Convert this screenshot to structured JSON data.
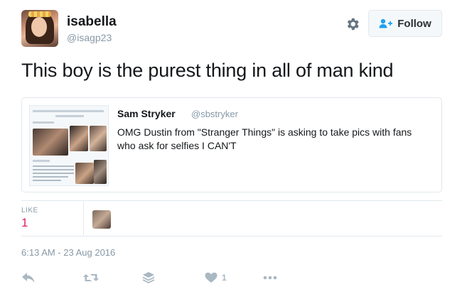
{
  "user": {
    "name": "isabella",
    "handle": "@isagp23"
  },
  "follow_button": {
    "label": "Follow"
  },
  "tweet": {
    "text": "This boy is the purest thing in all of man kind",
    "timestamp": "6:13 AM - 23 Aug 2016"
  },
  "quoted_tweet": {
    "name": "Sam Stryker",
    "handle": "@sbstryker",
    "text": "OMG Dustin from \"Stranger Things\" is asking to take pics with fans who ask for selfies I CAN'T"
  },
  "stats": {
    "like_label": "LIKE",
    "like_count": "1"
  },
  "actions": {
    "reply_icon": "reply-icon",
    "retweet_icon": "retweet-icon",
    "buffer_icon": "stack-icon",
    "like_icon": "heart-icon",
    "like_count": "1",
    "more_icon": "more-dots-icon"
  },
  "colors": {
    "like_accent": "#e0245e",
    "muted": "#8899a6",
    "border": "#e1e8ed"
  }
}
